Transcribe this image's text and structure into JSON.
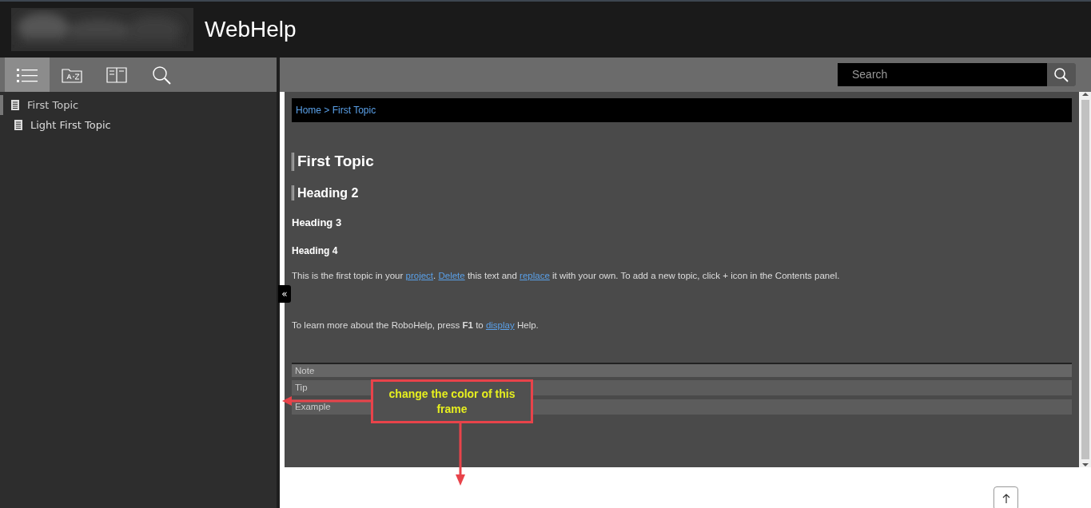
{
  "header": {
    "title": "WebHelp"
  },
  "sidebar": {
    "tabs": [
      {
        "selected": true
      },
      {
        "selected": false
      },
      {
        "selected": false
      },
      {
        "selected": false
      }
    ],
    "items": [
      {
        "label": "First Topic",
        "selected": true
      },
      {
        "label": "Light First Topic",
        "selected": false
      }
    ]
  },
  "toolbar": {
    "search": {
      "placeholder": "Search"
    }
  },
  "collapse_button": "«",
  "topic": {
    "breadcrumb": [
      {
        "text": "Home",
        "kind": "link"
      },
      {
        "text": " > ",
        "kind": "separator"
      },
      {
        "text": "First Topic",
        "kind": "link"
      }
    ],
    "headings": [
      {
        "kind": "h1",
        "text": "First Topic"
      },
      {
        "kind": "h2",
        "text": "Heading 2"
      },
      {
        "kind": "h3",
        "text": "Heading 3"
      },
      {
        "kind": "h4",
        "text": "Heading 4"
      }
    ],
    "paragraphs": [
      [
        {
          "text": "This is the first topic in your ",
          "kind": "text"
        },
        {
          "text": "project",
          "kind": "link"
        },
        {
          "text": ". ",
          "kind": "text"
        },
        {
          "text": "Delete",
          "kind": "link"
        },
        {
          "text": " this text and ",
          "kind": "text"
        },
        {
          "text": "replace",
          "kind": "link"
        },
        {
          "text": " it with your own. To add a new topic, click + icon in the Contents panel.",
          "kind": "text"
        }
      ],
      [
        {
          "text": "To learn more about the RoboHelp, press **F1** to ",
          "kind": "text"
        },
        {
          "text": "display",
          "kind": "link"
        },
        {
          "text": " Help.",
          "kind": "text"
        }
      ]
    ],
    "boxes": [
      {
        "label": "Note",
        "kind": "header"
      },
      {
        "label": "Tip",
        "kind": "row"
      },
      {
        "label": "Example",
        "kind": "row"
      }
    ]
  },
  "annotation": {
    "text": "change the color of this frame"
  }
}
